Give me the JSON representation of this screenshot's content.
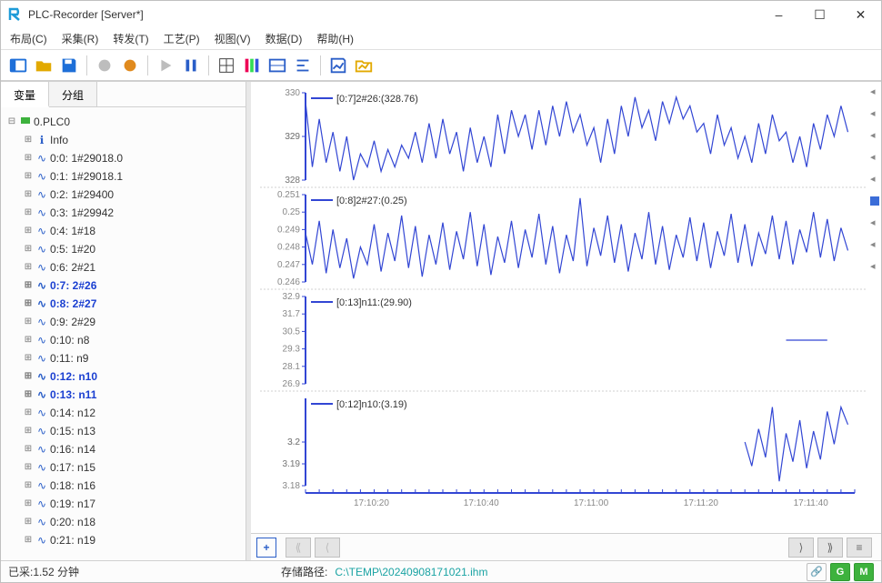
{
  "window": {
    "title": "PLC-Recorder  [Server*]"
  },
  "menu": {
    "items": [
      "布局(C)",
      "采集(R)",
      "转发(T)",
      "工艺(P)",
      "视图(V)",
      "数据(D)",
      "帮助(H)"
    ]
  },
  "toolbar": {
    "buttons": [
      {
        "name": "panel-icon",
        "color": "#1e6fd8",
        "title": "面板"
      },
      {
        "name": "open-icon",
        "color": "#e2a900",
        "title": "打开"
      },
      {
        "name": "save-icon",
        "color": "#1e6fd8",
        "title": "保存"
      },
      {
        "sep": true
      },
      {
        "name": "record-gray-icon",
        "color": "#bdbdbd",
        "title": "录制"
      },
      {
        "name": "record-orange-icon",
        "color": "#e08a1e",
        "title": "录制中"
      },
      {
        "sep": true
      },
      {
        "name": "play-icon",
        "color": "#bdbdbd",
        "title": "播放"
      },
      {
        "name": "pause-icon",
        "color": "#2a5ec8",
        "title": "暂停"
      },
      {
        "sep": true
      },
      {
        "name": "grid-icon",
        "color": "#333",
        "title": "网格"
      },
      {
        "name": "palette-icon",
        "color": "#d04fae",
        "title": "配色"
      },
      {
        "name": "ruler-icon",
        "color": "#2a5ec8",
        "title": "标尺"
      },
      {
        "name": "align-icon",
        "color": "#2a5ec8",
        "title": "对齐"
      },
      {
        "sep": true
      },
      {
        "name": "save-chart-icon",
        "color": "#2a5ec8",
        "title": "保存图"
      },
      {
        "name": "export-icon",
        "color": "#e2a900",
        "title": "导出"
      }
    ]
  },
  "left_tabs": {
    "items": [
      "变量",
      "分组"
    ],
    "active": 0
  },
  "tree": {
    "root": "0.PLC0",
    "info": "Info",
    "items": [
      {
        "label": "0:0: 1#29018.0"
      },
      {
        "label": "0:1: 1#29018.1"
      },
      {
        "label": "0:2: 1#29400"
      },
      {
        "label": "0:3: 1#29942"
      },
      {
        "label": "0:4: 1#18"
      },
      {
        "label": "0:5: 1#20"
      },
      {
        "label": "0:6: 2#21"
      },
      {
        "label": "0:7: 2#26",
        "bold": true
      },
      {
        "label": "0:8: 2#27",
        "bold": true
      },
      {
        "label": "0:9: 2#29"
      },
      {
        "label": "0:10: n8"
      },
      {
        "label": "0:11: n9"
      },
      {
        "label": "0:12: n10",
        "bold": true
      },
      {
        "label": "0:13: n11",
        "bold": true
      },
      {
        "label": "0:14: n12"
      },
      {
        "label": "0:15: n13"
      },
      {
        "label": "0:16: n14"
      },
      {
        "label": "0:17: n15"
      },
      {
        "label": "0:18: n16"
      },
      {
        "label": "0:19: n17"
      },
      {
        "label": "0:20: n18"
      },
      {
        "label": "0:21: n19"
      }
    ]
  },
  "time_axis": {
    "ticks": [
      "17:10:20",
      "17:10:40",
      "17:11:00",
      "17:11:20",
      "17:11:40"
    ]
  },
  "chart_data": [
    {
      "type": "line",
      "title_prefix": "[0:7]2#26:",
      "current": "(328.76)",
      "ylim": [
        328,
        330
      ],
      "yticks": [
        328,
        328,
        329,
        329,
        329,
        330
      ],
      "x": [
        0,
        1,
        2,
        3,
        4,
        5,
        6,
        7,
        8,
        9,
        10,
        11,
        12,
        13,
        14,
        15,
        16,
        17,
        18,
        19,
        20,
        21,
        22,
        23,
        24,
        25,
        26,
        27,
        28,
        29,
        30,
        31,
        32,
        33,
        34,
        35,
        36,
        37,
        38,
        39,
        40,
        41,
        42,
        43,
        44,
        45,
        46,
        47,
        48,
        49,
        50,
        51,
        52,
        53,
        54,
        55,
        56,
        57,
        58,
        59,
        60,
        61,
        62,
        63,
        64,
        65,
        66,
        67,
        68,
        69,
        70,
        71,
        72,
        73,
        74,
        75,
        76,
        77,
        78,
        79
      ],
      "values": [
        329.8,
        328.3,
        329.4,
        328.4,
        329.1,
        328.2,
        329.0,
        328.0,
        328.6,
        328.3,
        328.9,
        328.2,
        328.7,
        328.3,
        328.8,
        328.5,
        329.1,
        328.4,
        329.3,
        328.5,
        329.4,
        328.6,
        329.1,
        328.2,
        329.2,
        328.4,
        329.0,
        328.3,
        329.5,
        328.6,
        329.6,
        329.0,
        329.5,
        328.7,
        329.6,
        328.8,
        329.7,
        329.0,
        329.8,
        329.1,
        329.5,
        328.8,
        329.2,
        328.4,
        329.4,
        328.6,
        329.7,
        329.0,
        329.9,
        329.2,
        329.6,
        328.9,
        329.8,
        329.3,
        329.9,
        329.4,
        329.7,
        329.1,
        329.3,
        328.6,
        329.5,
        328.8,
        329.2,
        328.5,
        329.0,
        328.4,
        329.3,
        328.6,
        329.5,
        328.9,
        329.1,
        328.4,
        329.0,
        328.3,
        329.3,
        328.7,
        329.5,
        329.0,
        329.7,
        329.1
      ]
    },
    {
      "type": "line",
      "title_prefix": "[0:8]2#27:",
      "current": "(0.25)",
      "ylim": [
        0.246,
        0.251
      ],
      "yticks": [
        0.246,
        0.247,
        0.248,
        0.249,
        0.25,
        0.251
      ],
      "x": [
        0,
        1,
        2,
        3,
        4,
        5,
        6,
        7,
        8,
        9,
        10,
        11,
        12,
        13,
        14,
        15,
        16,
        17,
        18,
        19,
        20,
        21,
        22,
        23,
        24,
        25,
        26,
        27,
        28,
        29,
        30,
        31,
        32,
        33,
        34,
        35,
        36,
        37,
        38,
        39,
        40,
        41,
        42,
        43,
        44,
        45,
        46,
        47,
        48,
        49,
        50,
        51,
        52,
        53,
        54,
        55,
        56,
        57,
        58,
        59,
        60,
        61,
        62,
        63,
        64,
        65,
        66,
        67,
        68,
        69,
        70,
        71,
        72,
        73,
        74,
        75,
        76,
        77,
        78,
        79
      ],
      "values": [
        0.2488,
        0.247,
        0.2495,
        0.2465,
        0.249,
        0.2468,
        0.2485,
        0.2462,
        0.248,
        0.247,
        0.2493,
        0.2466,
        0.2488,
        0.2472,
        0.2498,
        0.2468,
        0.2492,
        0.2463,
        0.2487,
        0.247,
        0.2494,
        0.2467,
        0.2489,
        0.2473,
        0.25,
        0.2469,
        0.2493,
        0.2464,
        0.2486,
        0.2471,
        0.2495,
        0.2468,
        0.249,
        0.2474,
        0.2499,
        0.247,
        0.2492,
        0.2465,
        0.2487,
        0.2472,
        0.2508,
        0.2469,
        0.2491,
        0.2475,
        0.2498,
        0.2471,
        0.2493,
        0.2466,
        0.2488,
        0.2473,
        0.25,
        0.247,
        0.2492,
        0.2467,
        0.2487,
        0.2474,
        0.2497,
        0.2472,
        0.2494,
        0.2468,
        0.2489,
        0.2475,
        0.2499,
        0.2471,
        0.2493,
        0.2469,
        0.2488,
        0.2476,
        0.2498,
        0.2473,
        0.2495,
        0.247,
        0.249,
        0.2477,
        0.25,
        0.2474,
        0.2496,
        0.2472,
        0.2491,
        0.2478
      ]
    },
    {
      "type": "line",
      "title_prefix": "[0:13]n11:",
      "current": "(29.90)",
      "ylim": [
        26.9,
        32.9
      ],
      "yticks": [
        26.9,
        28.1,
        29.3,
        30.5,
        31.7,
        32.9
      ],
      "x": [
        70,
        71,
        72,
        73,
        74,
        75,
        76
      ],
      "values": [
        29.9,
        29.9,
        29.9,
        29.9,
        29.9,
        29.9,
        29.9
      ]
    },
    {
      "type": "line",
      "title_prefix": "[0:12]n10:",
      "current": "(3.19)",
      "ylim": [
        3.18,
        3.22
      ],
      "yticks": [
        3.18,
        3.19,
        3.19,
        3.2,
        3.2,
        3.2
      ],
      "x": [
        64,
        65,
        66,
        67,
        68,
        69,
        70,
        71,
        72,
        73,
        74,
        75,
        76,
        77,
        78,
        79
      ],
      "values": [
        3.2,
        3.189,
        3.206,
        3.193,
        3.216,
        3.182,
        3.204,
        3.191,
        3.21,
        3.188,
        3.205,
        3.192,
        3.214,
        3.199,
        3.216,
        3.208
      ]
    }
  ],
  "navstrip": {
    "plus": "+"
  },
  "status": {
    "left": "已采:1.52 分钟",
    "label": "存储路径:",
    "path": "C:\\TEMP\\20240908171021.ihm",
    "badges": [
      "G",
      "M"
    ]
  },
  "colors": {
    "series": "#3246d4",
    "accent": "#1e6fd8"
  }
}
